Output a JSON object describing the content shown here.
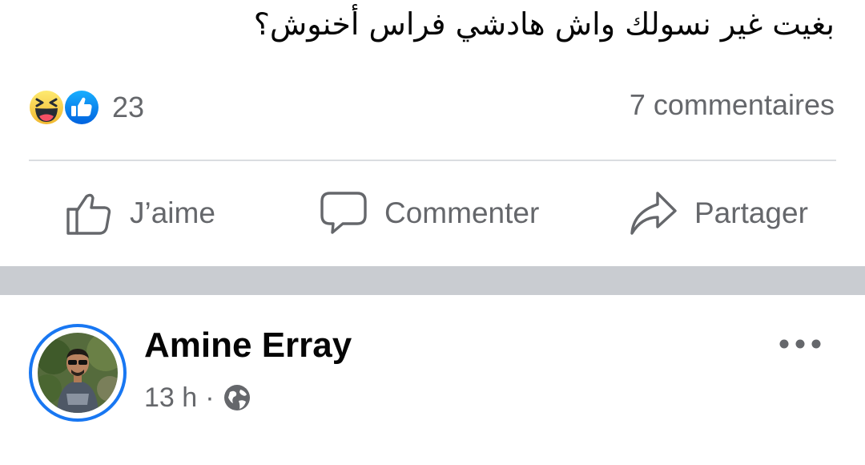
{
  "post": {
    "text": "بغيت غير نسولك واش هادشي فراس أخنوش؟",
    "reactions": {
      "types": [
        "haha-icon",
        "like-icon"
      ],
      "count": "23"
    },
    "comments_count": "7 commentaires",
    "actions": {
      "like_label": "J’aime",
      "comment_label": "Commenter",
      "share_label": "Partager"
    }
  },
  "next_post": {
    "author": "Amine Erray",
    "time": "13 h",
    "separator": "·",
    "audience_icon": "globe-icon",
    "more_icon": "more-options-icon"
  },
  "colors": {
    "accent": "#1877f2",
    "text_primary": "#050505",
    "text_secondary": "#65676b",
    "divider": "#dadde1",
    "section_gap": "#c9ccd1"
  }
}
